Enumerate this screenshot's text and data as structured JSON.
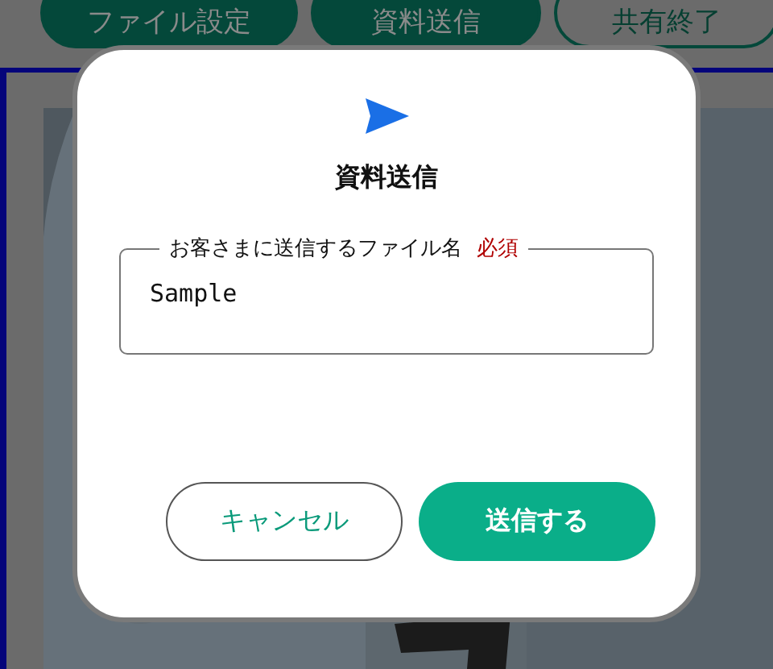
{
  "top_tabs": [
    {
      "label": "ファイル設定",
      "kind": "filled"
    },
    {
      "label": "資料送信",
      "kind": "filled"
    },
    {
      "label": "共有終了",
      "kind": "outlined"
    }
  ],
  "dialog": {
    "title": "資料送信",
    "field": {
      "label": "お客さまに送信するファイル名",
      "required_label": "必須",
      "value": "Sample"
    },
    "buttons": [
      {
        "label": "キャンセル",
        "kind": "secondary"
      },
      {
        "label": "送信する",
        "kind": "primary"
      }
    ]
  }
}
